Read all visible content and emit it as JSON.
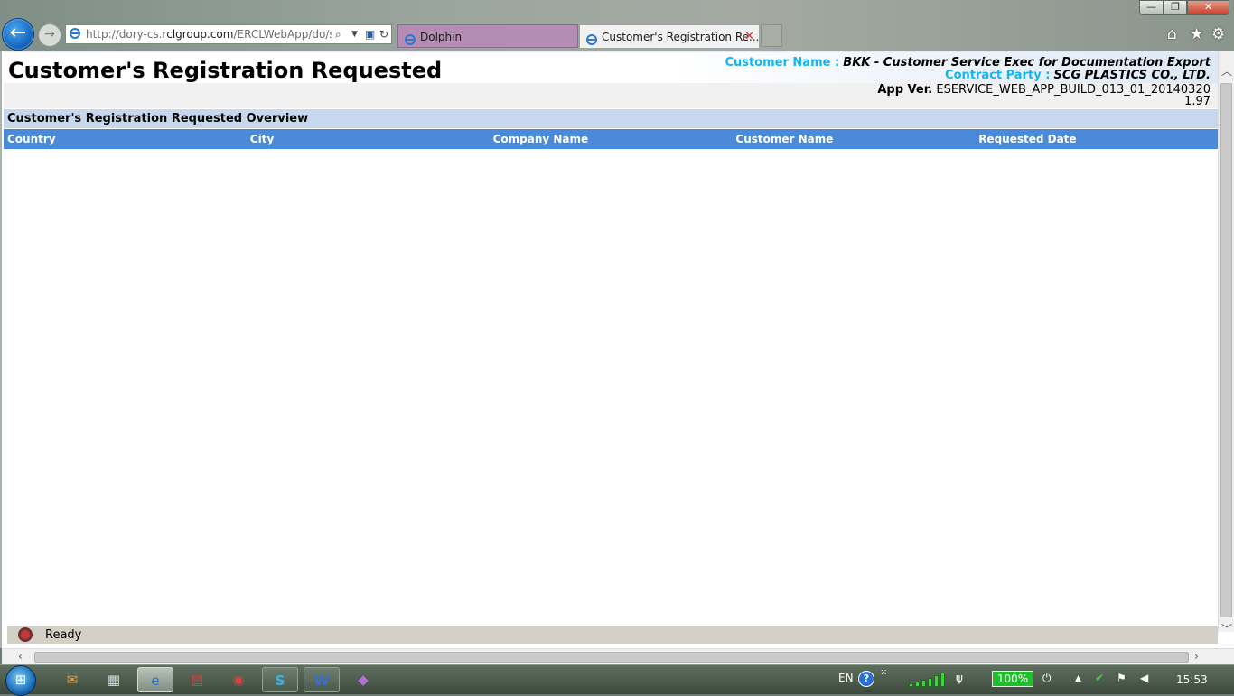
{
  "browser": {
    "address": {
      "url_pre": "http://dory-cs.",
      "url_domain": "rclgroup.com",
      "url_post": "/ERCLWebApp/do/sen"
    },
    "tabs": [
      {
        "label": "Dolphin"
      },
      {
        "label": "Customer's Registration Re...",
        "close": "✕"
      }
    ],
    "window_buttons": {
      "minimize": "—",
      "maximize": "❐",
      "close": "✕"
    },
    "commands": {
      "home": "⌂",
      "favorites": "★",
      "tools": "⚙"
    }
  },
  "page": {
    "title": "Customer's Registration Requested",
    "customer": {
      "name_label": "Customer Name :",
      "name_value": "BKK - Customer Service Exec for Documentation Export",
      "party_label": "Contract Party :",
      "party_value": "SCG PLASTICS CO., LTD."
    },
    "app_version": {
      "label": "App Ver.",
      "value": "ESERVICE_WEB_APP_BUILD_013_01_20140320",
      "number": "1.97"
    },
    "overview_title": "Customer's Registration Requested Overview",
    "columns": [
      "Country",
      "City",
      "Company Name",
      "Customer Name",
      "Requested Date"
    ],
    "rows": []
  },
  "statusbar": {
    "text": "Ready"
  },
  "taskbar": {
    "apps": [
      "outlook-icon",
      "calculator-icon",
      "ie-icon",
      "pdf-icon",
      "record-icon",
      "skype-icon",
      "word-icon",
      "onenote-icon"
    ],
    "tray": {
      "language": "EN",
      "help": "?",
      "battery": "100%",
      "clock": "15:53"
    }
  },
  "colors": {
    "header_blue": "#4a8ad8",
    "overview_blue": "#c7d8ee",
    "label_cyan": "#12b5f0",
    "dolphin_tab": "#b48cb4"
  }
}
